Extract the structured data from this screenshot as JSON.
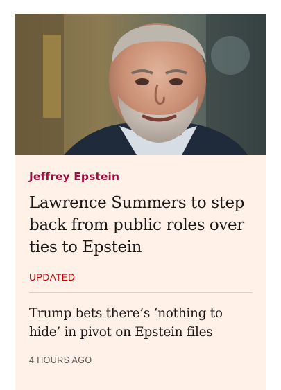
{
  "card": {
    "image_alt": "Portrait photo of Lawrence Summers",
    "topic": "Jeffrey Epstein",
    "headline": "Lawrence Summers to step back from public roles over ties to Epstein",
    "status": "UPDATED",
    "related": {
      "headline": "Trump bets there’s ‘nothing to hide’ in pivot on Epstein files",
      "timestamp": "4 HOURS AGO"
    }
  },
  "colors": {
    "card_background": "#fff1e8",
    "topic": "#990f3d",
    "status": "#cc0000",
    "text": "#1a1817",
    "muted": "#5a524e"
  }
}
